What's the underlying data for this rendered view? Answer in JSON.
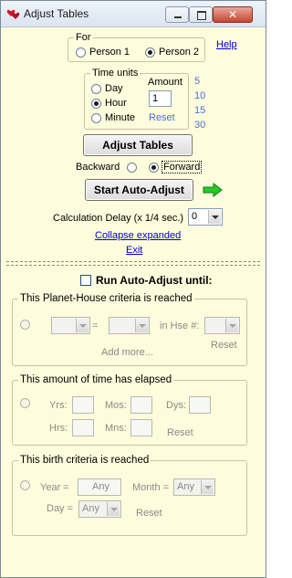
{
  "window": {
    "title": "Adjust Tables",
    "close_glyph": "✕"
  },
  "for_group": {
    "legend": "For",
    "options": [
      "Person 1",
      "Person 2"
    ],
    "selected": "Person 2",
    "help_link": "Help"
  },
  "time_units": {
    "legend": "Time units",
    "options": [
      "Day",
      "Hour",
      "Minute"
    ],
    "selected": "Hour",
    "amount_label": "Amount",
    "amount_value": "1",
    "reset_label": "Reset",
    "presets": [
      "5",
      "10",
      "15",
      "30"
    ]
  },
  "adjust_button": "Adjust Tables",
  "direction": {
    "backward": "Backward",
    "forward": "Forward",
    "selected": "Forward"
  },
  "start_button": "Start Auto-Adjust",
  "delay": {
    "label": "Calculation Delay (x 1/4 sec.)",
    "value": "0"
  },
  "links": {
    "collapse": "Collapse expanded",
    "exit": "Exit"
  },
  "run_until": {
    "label": "Run Auto-Adjust until:",
    "checked": false,
    "planet_house": {
      "legend": "This Planet-House criteria is reached",
      "equals": "=",
      "in_house_label": "in Hse #:",
      "add_more": "Add more...",
      "reset": "Reset"
    },
    "time_elapsed": {
      "legend": "This amount of time has elapsed",
      "yrs": "Yrs:",
      "mos": "Mos:",
      "dys": "Dys:",
      "hrs": "Hrs:",
      "mns": "Mns:",
      "reset": "Reset"
    },
    "birth": {
      "legend": "This birth criteria is reached",
      "year_label": "Year =",
      "year_value": "Any",
      "month_label": "Month =",
      "month_value": "Any",
      "day_label": "Day =",
      "day_value": "Any",
      "reset": "Reset"
    }
  },
  "colors": {
    "background": "#fdfcdc",
    "arrow": "#22cc22",
    "link": "#0000cc",
    "preset_blue": "#4a6fd6"
  }
}
